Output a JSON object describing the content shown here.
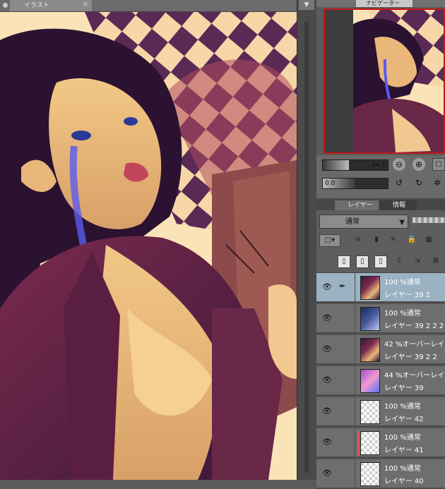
{
  "document": {
    "tab_label": "イラスト",
    "close_glyph": "×"
  },
  "navigator": {
    "tab_label": "ナビゲーター",
    "zoom_value": "24.5",
    "rotation_value": "0.0"
  },
  "layer_panel": {
    "tabs": [
      {
        "label": "レイヤー"
      },
      {
        "label": "情報"
      }
    ],
    "blend_mode": "通常",
    "layers": [
      {
        "line1": "100 %通常",
        "line2": "レイヤー 39 2",
        "selected": true,
        "thumb": "art"
      },
      {
        "line1": "100 %通常",
        "line2": "レイヤー 39 2 2 2",
        "selected": false,
        "thumb": "art-blue"
      },
      {
        "line1": "42 %オーバーレイ",
        "line2": "レイヤー 39 2 2",
        "selected": false,
        "thumb": "art"
      },
      {
        "line1": "44 %オーバーレイ",
        "line2": "レイヤー 39",
        "selected": false,
        "thumb": "pink"
      },
      {
        "line1": "100 %通常",
        "line2": "レイヤー 42",
        "selected": false,
        "thumb": "empty"
      },
      {
        "line1": "100 %通常",
        "line2": "レイヤー 41",
        "selected": false,
        "thumb": "empty"
      },
      {
        "line1": "100 %通常",
        "line2": "レイヤー 40",
        "selected": false,
        "thumb": "empty"
      }
    ]
  },
  "colors": {
    "selected_row": "#9ab2c2",
    "nav_border": "#c01818",
    "layer_mark": "#e05555"
  }
}
